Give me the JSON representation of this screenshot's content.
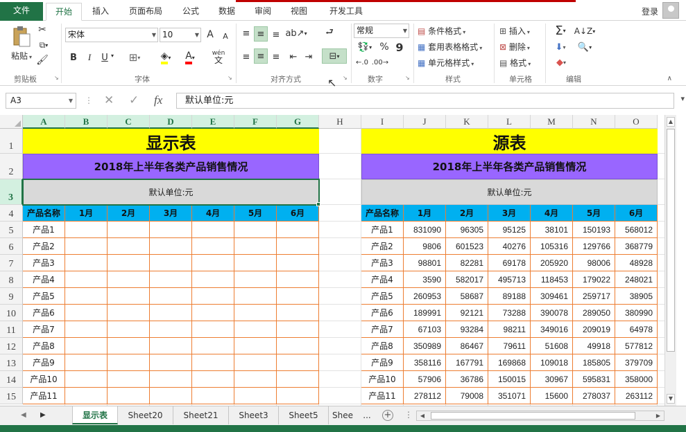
{
  "ribbon_tabs": [
    "文件",
    "开始",
    "插入",
    "页面布局",
    "公式",
    "数据",
    "审阅",
    "视图",
    "开发工具"
  ],
  "active_tab": "开始",
  "login_label": "登录",
  "ribbon": {
    "paste_label": "粘贴",
    "font_name": "宋体",
    "font_size": "10",
    "font_size_up": "A",
    "font_size_down": "A",
    "bold": "B",
    "italic": "I",
    "underline": "U",
    "wen_label": "wén",
    "wen_char": "文",
    "number_format": "常规",
    "percent": "%",
    "comma": "9",
    "cond_format": "条件格式",
    "table_format": "套用表格格式",
    "cell_style": "单元格样式",
    "insert": "插入",
    "delete": "删除",
    "format": "格式",
    "sum_icon": "Σ",
    "groups": [
      "剪贴板",
      "字体",
      "对齐方式",
      "数字",
      "样式",
      "单元格",
      "编辑"
    ]
  },
  "formula_bar": {
    "name_box": "A3",
    "cancel_icon": "✕",
    "confirm_icon": "✓",
    "fx_icon": "fx",
    "formula": "默认单位:元"
  },
  "columns": [
    "A",
    "B",
    "C",
    "D",
    "E",
    "F",
    "G",
    "H",
    "I",
    "J",
    "K",
    "L",
    "M",
    "N",
    "O"
  ],
  "rows": [
    "1",
    "2",
    "3",
    "4",
    "5",
    "6",
    "7",
    "8",
    "9",
    "10",
    "11",
    "12",
    "13",
    "14",
    "15"
  ],
  "display_table": {
    "title": "显示表",
    "subtitle": "2018年上半年各类产品销售情况",
    "unit": "默认单位:元",
    "headers": [
      "产品名称",
      "1月",
      "2月",
      "3月",
      "4月",
      "5月",
      "6月"
    ],
    "products": [
      "产品1",
      "产品2",
      "产品3",
      "产品4",
      "产品5",
      "产品6",
      "产品7",
      "产品8",
      "产品9",
      "产品10",
      "产品11"
    ]
  },
  "source_table": {
    "title": "源表",
    "subtitle": "2018年上半年各类产品销售情况",
    "unit": "默认单位:元",
    "headers": [
      "产品名称",
      "1月",
      "2月",
      "3月",
      "4月",
      "5月",
      "6月"
    ],
    "rows": [
      [
        "产品1",
        "831090",
        "96305",
        "95125",
        "38101",
        "150193",
        "568012"
      ],
      [
        "产品2",
        "9806",
        "601523",
        "40276",
        "105316",
        "129766",
        "368779"
      ],
      [
        "产品3",
        "98801",
        "82281",
        "69178",
        "205920",
        "98006",
        "48928"
      ],
      [
        "产品4",
        "3590",
        "582017",
        "495713",
        "118453",
        "179022",
        "248021"
      ],
      [
        "产品5",
        "260953",
        "58687",
        "89188",
        "309461",
        "259717",
        "38905"
      ],
      [
        "产品6",
        "189991",
        "92121",
        "73288",
        "390078",
        "289050",
        "380990"
      ],
      [
        "产品7",
        "67103",
        "93284",
        "98211",
        "349016",
        "209019",
        "64978"
      ],
      [
        "产品8",
        "350989",
        "86467",
        "79611",
        "51608",
        "49918",
        "577812"
      ],
      [
        "产品9",
        "358116",
        "167791",
        "169868",
        "109018",
        "185805",
        "379709"
      ],
      [
        "产品10",
        "57906",
        "36786",
        "150015",
        "30967",
        "595831",
        "358000"
      ],
      [
        "产品11",
        "278112",
        "79008",
        "351071",
        "15600",
        "278037",
        "263112"
      ]
    ]
  },
  "sheet_tabs": [
    "显示表",
    "Sheet20",
    "Sheet21",
    "Sheet3",
    "Sheet5",
    "Shee"
  ],
  "active_sheet": "显示表",
  "sheet_more": "...",
  "add_sheet": "+",
  "colors": {
    "title_bg": "#ffff00",
    "subtitle_bg": "#9966ff",
    "unit_bg": "#d9d9d9",
    "header_bg": "#00b0f0",
    "border": "#ed7d31",
    "accent": "#217346"
  }
}
